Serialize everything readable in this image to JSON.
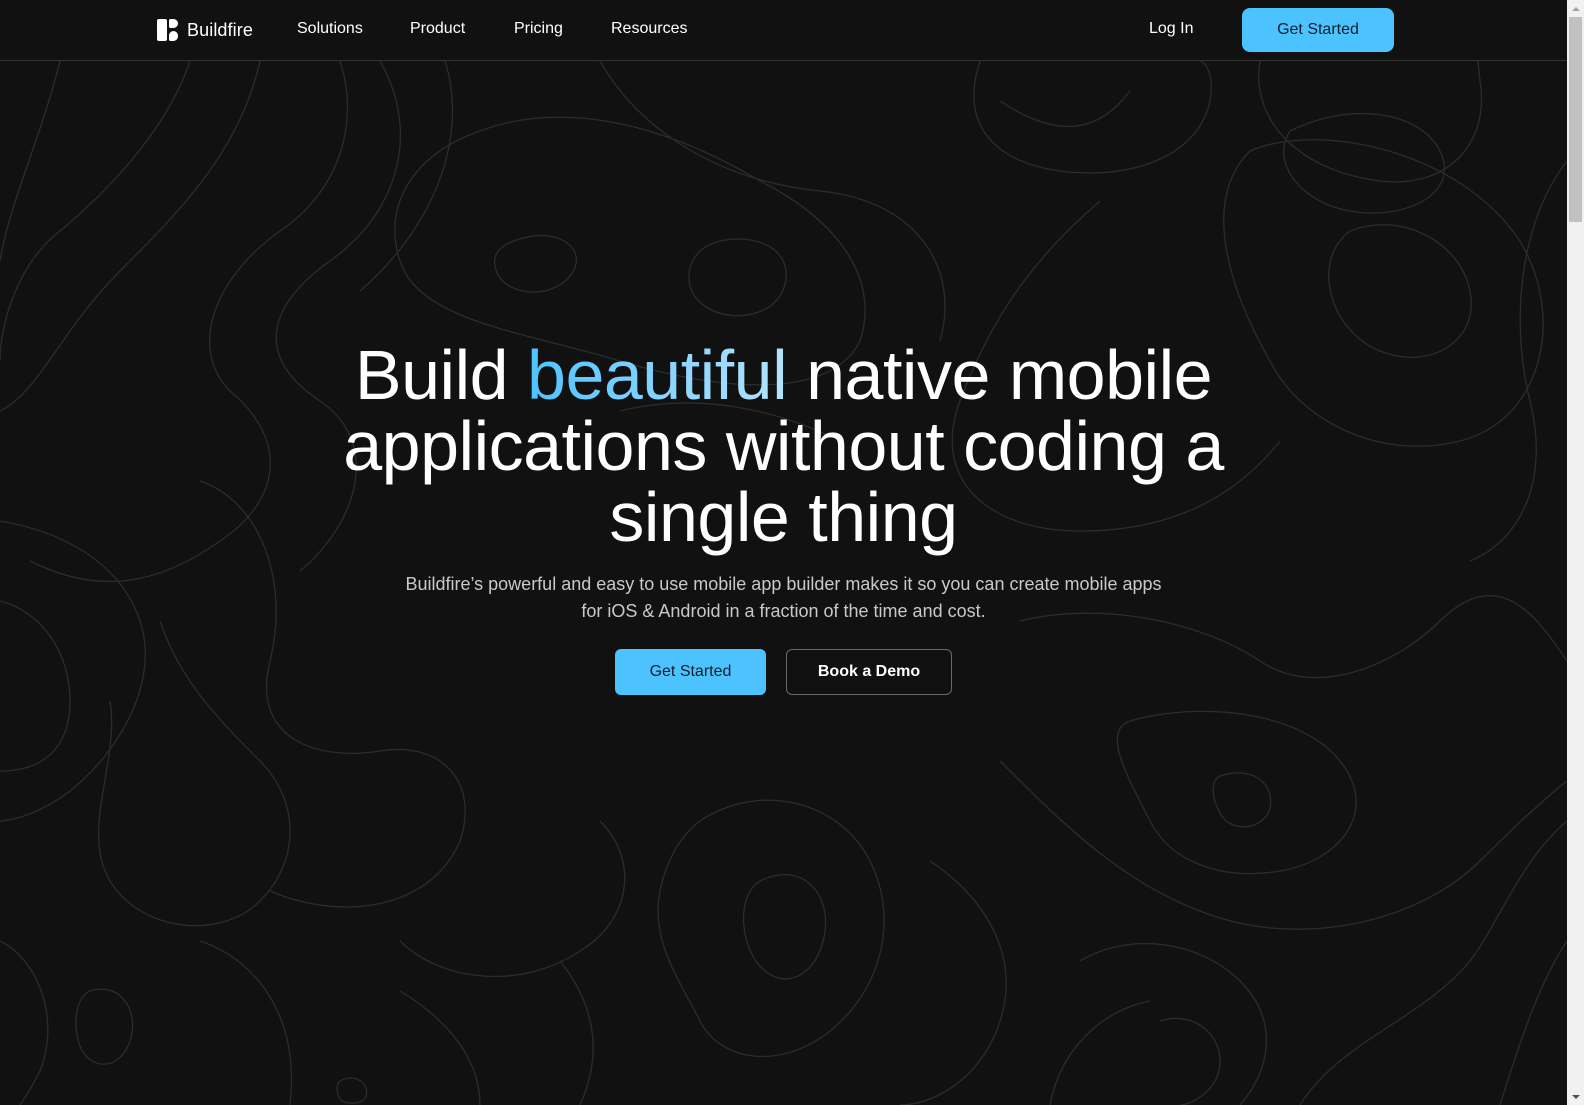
{
  "nav": {
    "brand": "Buildfire",
    "brand_icon": "buildfire-logo-icon",
    "items": [
      {
        "label": "Solutions"
      },
      {
        "label": "Product"
      },
      {
        "label": "Pricing"
      },
      {
        "label": "Resources"
      }
    ],
    "login_label": "Log In",
    "cta_label": "Get Started"
  },
  "hero": {
    "headline_before": "Build ",
    "headline_accent": "beautiful",
    "headline_after": " native mobile applications without coding a single thing",
    "subtitle": "Buildfire’s powerful and easy to use mobile app builder makes it so you can create mobile apps for iOS & Android in a fraction of the time and cost.",
    "primary_cta": "Get Started",
    "secondary_cta": "Book a Demo"
  },
  "colors": {
    "background": "#111111",
    "accent": "#4cc3ff",
    "accent_light": "#b3e4ff",
    "contour_lines": "#2c2c2c",
    "nav_border": "#333333"
  },
  "background_pattern": "topographic-contour-lines"
}
